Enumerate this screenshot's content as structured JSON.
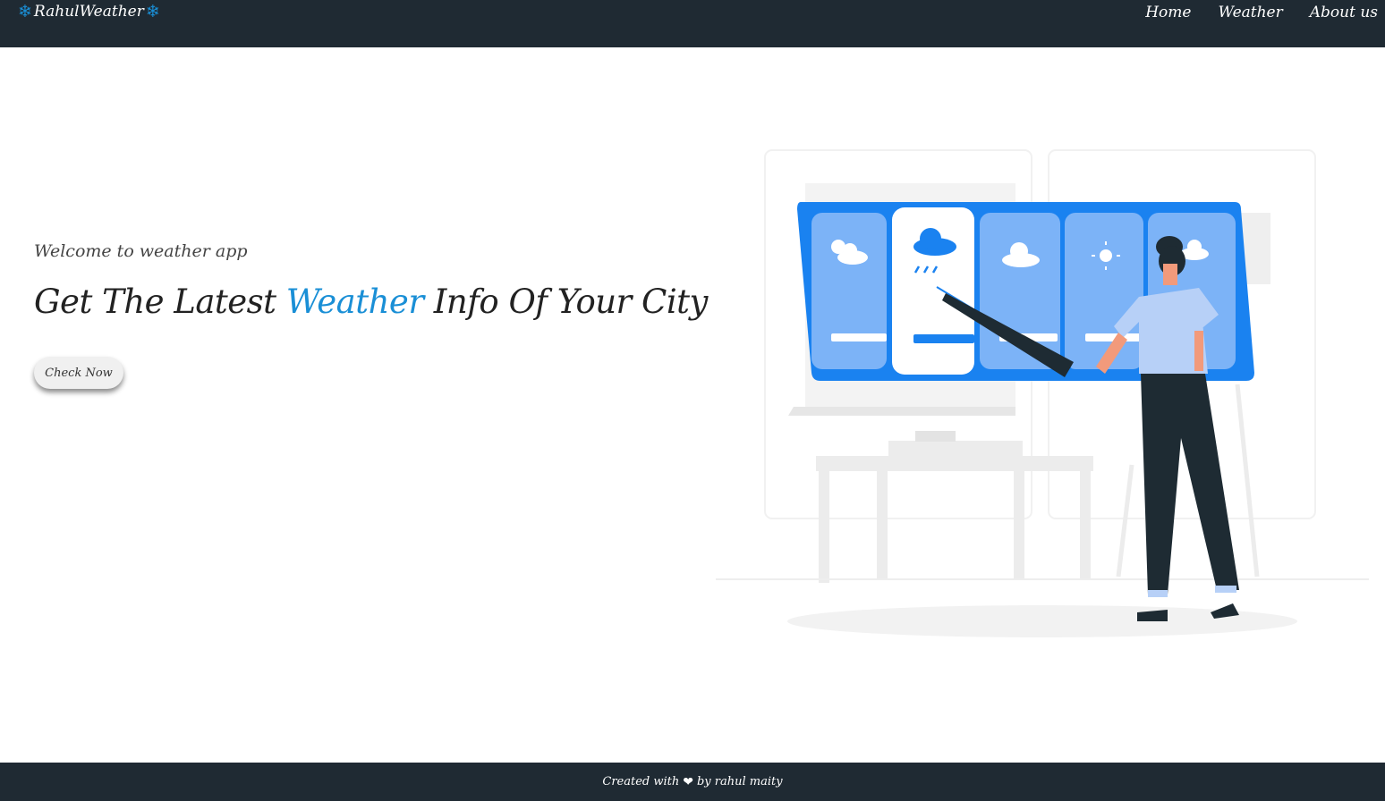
{
  "navbar": {
    "brand_icon": "❄",
    "brand": "RahulWeather",
    "links": [
      {
        "label": "Home"
      },
      {
        "label": "Weather"
      },
      {
        "label": "About us"
      }
    ]
  },
  "hero": {
    "welcome": "Welcome to weather app",
    "headline_before": "Get The Latest ",
    "headline_accent": "Weather",
    "headline_after": " Info Of Your City",
    "button": "Check Now"
  },
  "footer": {
    "prefix": "Created with",
    "heart": "❤",
    "suffix": "by rahul maity"
  },
  "colors": {
    "navbar_bg": "#1f2a33",
    "accent": "#1a8fd6",
    "board_blue": "#1a82f0"
  },
  "icons": [
    "snowflake-icon",
    "heart-icon",
    "sun-cloud-icon",
    "rain-cloud-icon",
    "cloud-icon",
    "sun-icon"
  ]
}
